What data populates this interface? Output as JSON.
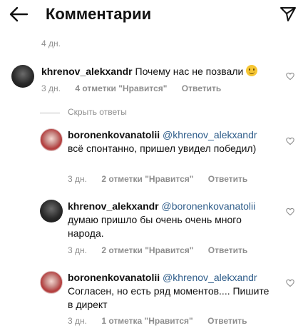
{
  "header": {
    "title": "Комментарии",
    "back_icon": "arrow-left-icon",
    "send_icon": "send-icon"
  },
  "post_age": "4 дн.",
  "comments": [
    {
      "username": "khrenov_alekxandr",
      "text": "Почему нас не позвали",
      "emoji": "slightly-smiling-face",
      "time": "3 дн.",
      "likes": "4 отметки \"Нравится\"",
      "reply": "Ответить"
    }
  ],
  "hide_replies": "Скрыть ответы",
  "replies": [
    {
      "username": "boronenkovanatolii",
      "mention": "@khrenov_alekxandr",
      "text": "всё спонтанно, пришел увидел победил)",
      "time": "3 дн.",
      "likes": "2 отметки \"Нравится\"",
      "reply": "Ответить"
    },
    {
      "username": "khrenov_alekxandr",
      "mention": "@boronenkovanatolii",
      "text": "думаю пришло бы очень очень много народа.",
      "time": "3 дн.",
      "likes": "2 отметки \"Нравится\"",
      "reply": "Ответить"
    },
    {
      "username": "boronenkovanatolii",
      "mention": "@khrenov_alekxandr",
      "text": "Согласен, но есть ряд моментов.... Пишите в директ",
      "time": "3 дн.",
      "likes": "1 отметка \"Нравится\"",
      "reply": "Ответить"
    }
  ],
  "colors": {
    "mention": "#2f5d8a",
    "meta": "#8e8e8e",
    "text": "#111111"
  }
}
